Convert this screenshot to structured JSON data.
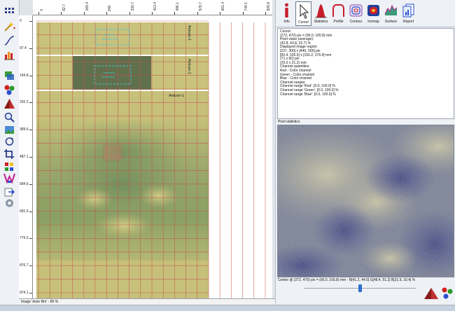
{
  "left_toolbar": {
    "items": [
      {
        "name": "grid-icon"
      },
      {
        "name": "magic-add-icon"
      },
      {
        "name": "curve-icon"
      },
      {
        "name": "bar-chart-icon"
      },
      {
        "name": "layer-icon"
      },
      {
        "name": "color-balls-icon"
      },
      {
        "name": "pyramid-icon"
      },
      {
        "name": "magnifier-icon"
      },
      {
        "name": "image-adjust-icon"
      },
      {
        "name": "rotate-icon"
      },
      {
        "name": "crop-icon"
      },
      {
        "name": "transform-icon"
      },
      {
        "name": "palette-icon"
      },
      {
        "name": "export-icon"
      },
      {
        "name": "settings-icon"
      }
    ]
  },
  "rulers": {
    "x_labels": [
      "0",
      "82.7",
      "165.4",
      "248",
      "330.7",
      "413.4",
      "496.1",
      "578.7",
      "661.4",
      "744.1",
      "826.8"
    ],
    "y_labels": [
      "0",
      "97.4",
      "194.8",
      "292.2",
      "389.6",
      "487.1",
      "584.5",
      "681.9",
      "779.3",
      "876.7",
      "974.1"
    ]
  },
  "canvas": {
    "film_labels": [
      "Aetusn-1",
      "Aetusn-1",
      "Aetusn-1"
    ],
    "reference_roi_1": [
      "reference",
      "reference ROI"
    ],
    "reference_roi_2": [
      "reference",
      "unexposed"
    ]
  },
  "status_bar": {
    "text": "Image 'dose film' - 89 %"
  },
  "mode_toolbar": {
    "buttons": [
      {
        "name": "info",
        "label": "Info",
        "active": false
      },
      {
        "name": "cursor",
        "label": "Cursor",
        "active": true
      },
      {
        "name": "statistics",
        "label": "Statistics",
        "active": false
      },
      {
        "name": "profile",
        "label": "Profile",
        "active": false
      },
      {
        "name": "contour",
        "label": "Contour",
        "active": false
      },
      {
        "name": "isomap",
        "label": "Isomap",
        "active": false
      },
      {
        "name": "surface",
        "label": "Surface",
        "active": false
      },
      {
        "name": "report",
        "label": "Report",
        "active": false
      }
    ]
  },
  "info_panel": {
    "lines": [
      "Cursor:",
      "  (272, 470) pix = (96.0, 165.8) mm",
      "Pixel value (average):",
      "  (42.8, 43.8, 32.7) %",
      "Displayed image region:",
      "  [237, 300] x [440, 500] pix",
      "  [83.4, 105.5] x [155.2, 176.4] mm",
      "  (71 x 60) pix",
      "  (25.0 x 21.2) mm",
      "Channel quantities:",
      "  Red - Color channel",
      "  Green - Color channel",
      "  Blue - Color channel",
      "Channel ranges:",
      "  Channel range 'Red':  [0.0, 100.0] %",
      "  Channel range 'Green':  [0.0, 100.0] %",
      "  Channel range 'Blue':  [0.0, 100.0] %"
    ]
  },
  "pixel_statistics": {
    "label": "Pixel statistics",
    "caption": "Center @ (272, 470) pix = (96.0, 165.8) mm - R[41.2, 44.5]  G[48.4, 51.2]  B[31.9, 33.4]  %"
  },
  "zoom": {
    "level": 0.5
  },
  "colors": {
    "film_yellow": "#c7c07a",
    "film_green": "#76905a",
    "grid_red": "#c65050",
    "roi_cyan": "#3fc8d8",
    "slider_blue": "#2f6fd0",
    "active_border": "#6b7a8c"
  }
}
